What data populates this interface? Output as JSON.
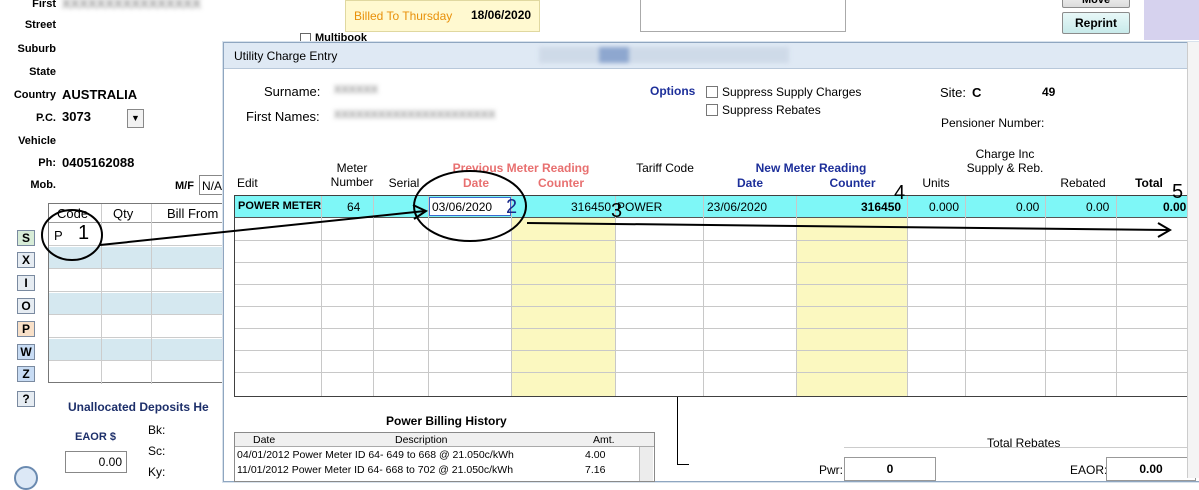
{
  "background_form": {
    "labels": {
      "first": "First",
      "street": "Street",
      "suburb": "Suburb",
      "state": "State",
      "country": "Country",
      "pc": "P.C.",
      "vehicle": "Vehicle",
      "ph": "Ph:",
      "mob": "Mob.",
      "mf": "M/F"
    },
    "values": {
      "country": "AUSTRALIA",
      "pc": "3073",
      "ph": "0405162088",
      "mf": "N/A"
    },
    "billed_to_label": "Billed To Thursday",
    "billed_to_date": "18/06/2020",
    "multibook_label": "Multibook",
    "buttons": {
      "move": "Move",
      "reprint": "Reprint"
    },
    "code_table": {
      "headers": [
        "Code",
        "Qty",
        "Bill From"
      ],
      "first_code": "P"
    },
    "side_buttons": [
      "S",
      "X",
      "I",
      "O",
      "P",
      "W",
      "Z",
      "?"
    ],
    "unallocated_deposits": "Unallocated Deposits He",
    "eaor_label": "EAOR $",
    "eaor_value": "0.00",
    "bk_label": "Bk:",
    "sc_label": "Sc:",
    "ky_label": "Ky:"
  },
  "dialog": {
    "title": "Utility Charge Entry",
    "surname_label": "Surname:",
    "first_names_label": "First Names:",
    "options_label": "Options",
    "suppress_supply": "Suppress Supply Charges",
    "suppress_rebates": "Suppress Rebates",
    "site_label": "Site:",
    "site_code": "C",
    "site_number": "49",
    "pensioner_label": "Pensioner Number:",
    "headers": {
      "edit": "Edit",
      "meter_number": "Meter Number",
      "serial": "Serial",
      "prev_group": "Previous Meter Reading",
      "prev_date": "Date",
      "prev_counter": "Counter",
      "tariff_code": "Tariff Code",
      "new_group": "New Meter Reading",
      "new_date": "Date",
      "new_counter": "Counter",
      "units": "Units",
      "charge": "Charge Inc Supply & Reb.",
      "rebated": "Rebated",
      "total": "Total"
    },
    "row": {
      "edit": "POWER METER",
      "meter_number": "64",
      "prev_date": "03/06/2020",
      "prev_counter": "316450",
      "tariff_code": "POWER",
      "new_date": "23/06/2020",
      "new_counter": "316450",
      "units": "0.000",
      "charge": "0.00",
      "rebated": "0.00",
      "total": "0.00"
    },
    "history": {
      "title": "Power Billing History",
      "headers": [
        "Date",
        "Description",
        "Amt."
      ],
      "rows": [
        {
          "date": "04/01/2012",
          "desc": "Power Meter ID 64- 649 to 668 @  21.050c/kWh",
          "amt": "4.00"
        },
        {
          "date": "11/01/2012",
          "desc": "Power Meter ID 64- 668 to 702 @  21.050c/kWh",
          "amt": "7.16"
        }
      ]
    },
    "total_rebates_label": "Total Rebates",
    "pwr_label": "Pwr:",
    "pwr_value": "0",
    "eaor_label": "EAOR:",
    "eaor_value": "0.00"
  },
  "annotations": [
    "1",
    "2",
    "3",
    "4",
    "5"
  ],
  "colors": {
    "selected_row": "#7ef7f7",
    "new_counter_column": "#fbf8c0",
    "title_blue": "#1d2f9a",
    "prev_red": "#e87070",
    "billed_yellow": "#fff9d0",
    "billed_text": "#e8900a"
  }
}
